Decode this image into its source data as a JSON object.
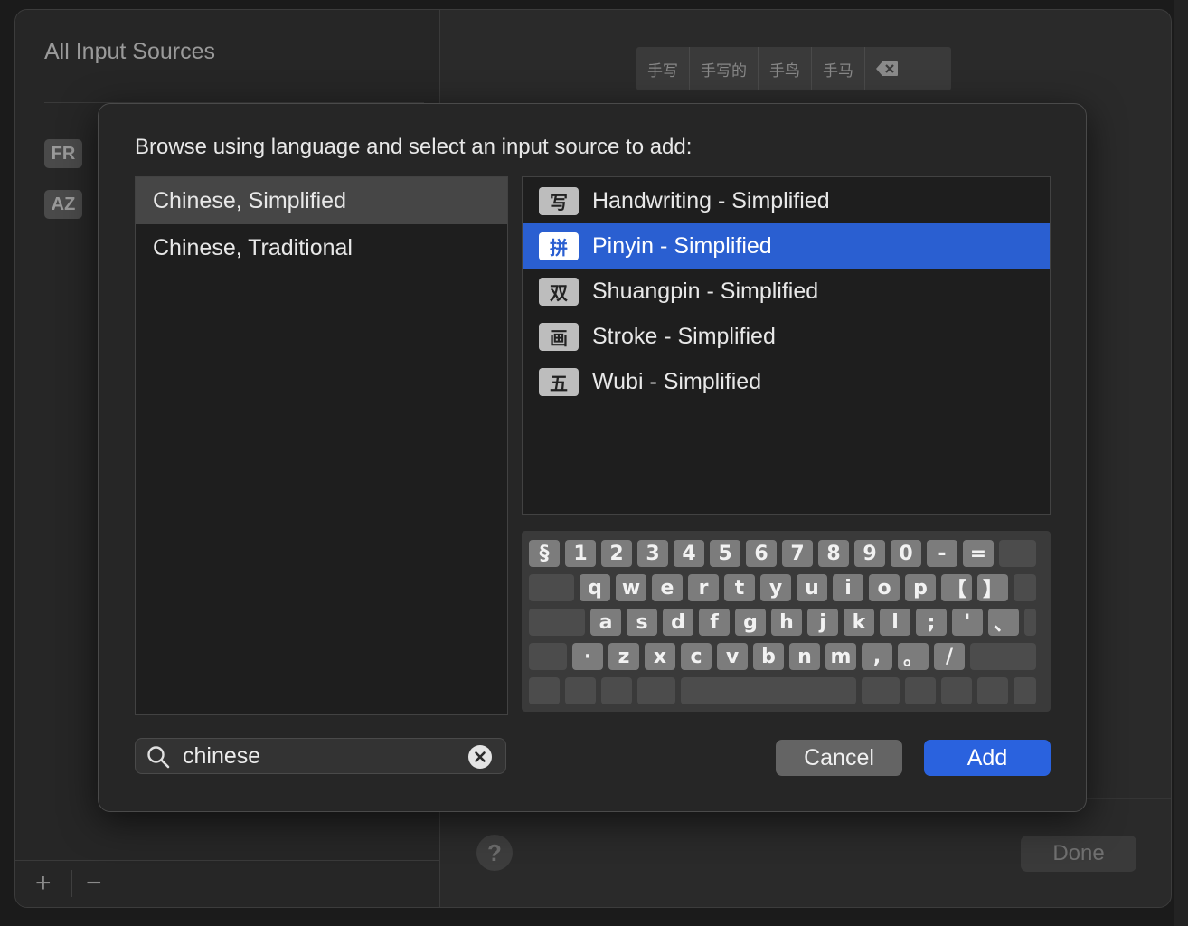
{
  "background_window": {
    "title": "All Input Sources",
    "badges": [
      "FR",
      "AZ"
    ],
    "add_label": "+",
    "remove_label": "−",
    "help_label": "?",
    "done_label": "Done",
    "candidates": [
      "手写",
      "手写的",
      "手鸟",
      "手马"
    ]
  },
  "sheet": {
    "prompt": "Browse using language and select an input source to add:",
    "languages": [
      {
        "label": "Chinese, Simplified",
        "selected": true
      },
      {
        "label": "Chinese, Traditional",
        "selected": false
      }
    ],
    "sources": [
      {
        "icon": "写",
        "label": "Handwriting - Simplified",
        "selected": false
      },
      {
        "icon": "拼",
        "label": "Pinyin - Simplified",
        "selected": true
      },
      {
        "icon": "双",
        "label": "Shuangpin - Simplified",
        "selected": false
      },
      {
        "icon": "画",
        "label": "Stroke - Simplified",
        "selected": false
      },
      {
        "icon": "五",
        "label": "Wubi - Simplified",
        "selected": false
      }
    ],
    "keyboard": {
      "row1": [
        "§",
        "1",
        "2",
        "3",
        "4",
        "5",
        "6",
        "7",
        "8",
        "9",
        "0",
        "-",
        "="
      ],
      "row2": [
        "q",
        "w",
        "e",
        "r",
        "t",
        "y",
        "u",
        "i",
        "o",
        "p",
        "【",
        "】"
      ],
      "row3": [
        "a",
        "s",
        "d",
        "f",
        "g",
        "h",
        "j",
        "k",
        "l",
        ";",
        "'",
        "、"
      ],
      "row4": [
        "·",
        "z",
        "x",
        "c",
        "v",
        "b",
        "n",
        "m",
        ",",
        "。",
        "/"
      ]
    },
    "search": {
      "value": "chinese",
      "placeholder": "Search"
    },
    "cancel_label": "Cancel",
    "add_label": "Add"
  },
  "colors": {
    "accent": "#2a62de",
    "selection": "#2a5fd1"
  }
}
